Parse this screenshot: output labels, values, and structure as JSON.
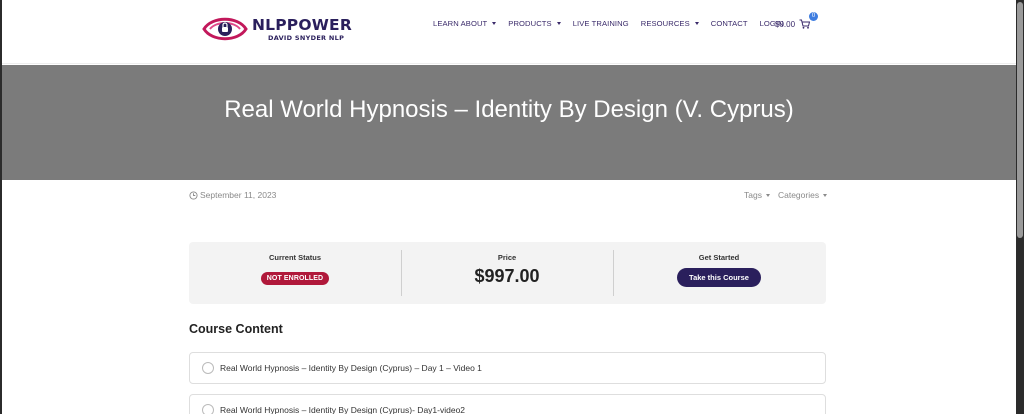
{
  "brand": {
    "name": "NLPPOWER",
    "tagline": "DAVID SNYDER NLP",
    "colors": {
      "primary": "#2a1f5c",
      "accent": "#c2185b"
    }
  },
  "nav": {
    "items": [
      {
        "label": "LEARN ABOUT",
        "has_dropdown": true
      },
      {
        "label": "PRODUCTS",
        "has_dropdown": true
      },
      {
        "label": "LIVE TRAINING",
        "has_dropdown": false
      },
      {
        "label": "RESOURCES",
        "has_dropdown": true
      },
      {
        "label": "CONTACT",
        "has_dropdown": false
      },
      {
        "label": "LOGIN",
        "has_dropdown": false
      }
    ],
    "cart": {
      "amount": "$0.00",
      "count": "0",
      "icon": "cart-icon"
    }
  },
  "hero": {
    "title": "Real World Hypnosis – Identity By Design (V. Cyprus)"
  },
  "meta": {
    "date": "September 11, 2023",
    "tags_label": "Tags",
    "categories_label": "Categories"
  },
  "status": {
    "current_status_label": "Current Status",
    "current_status_value": "NOT ENROLLED",
    "price_label": "Price",
    "price_value": "$997.00",
    "get_started_label": "Get Started",
    "cta_label": "Take this Course",
    "colors": {
      "badge": "#b0183a",
      "button": "#2a1f5c"
    }
  },
  "course": {
    "heading": "Course Content",
    "lessons": [
      {
        "title": "Real World Hypnosis – Identity By Design (Cyprus) – Day 1 – Video 1"
      },
      {
        "title": "Real World Hypnosis – Identity By Design (Cyprus)- Day1-video2"
      }
    ]
  }
}
